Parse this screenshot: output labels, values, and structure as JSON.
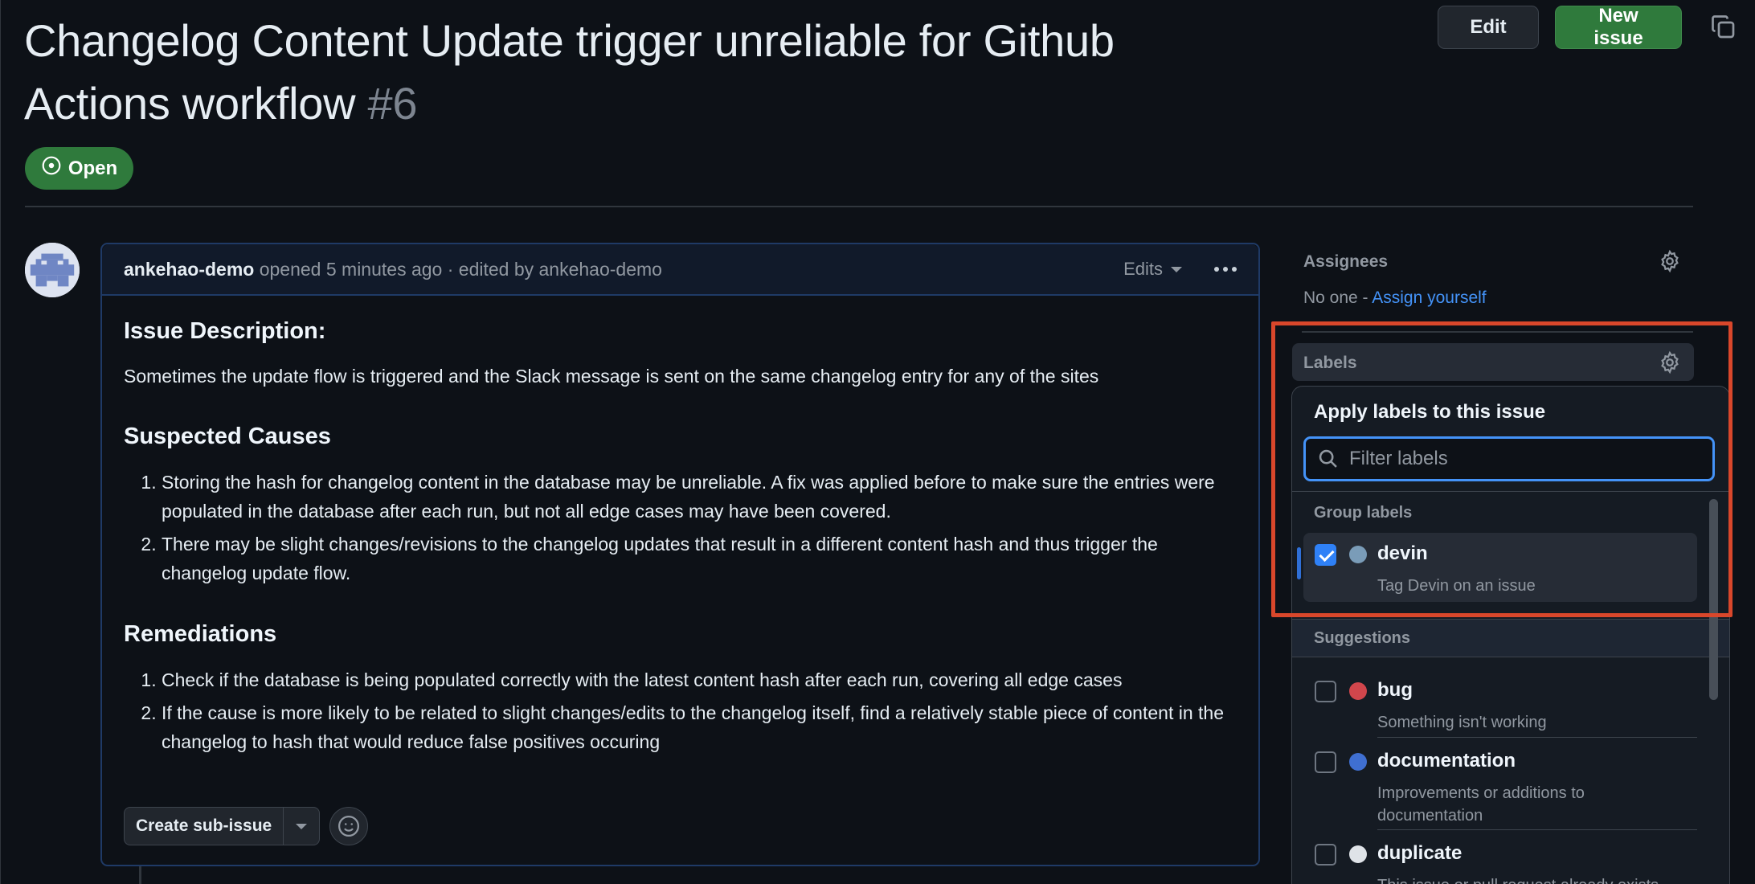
{
  "issue": {
    "title": "Changelog Content Update trigger unreliable for Github Actions workflow",
    "number": "#6",
    "state": "Open"
  },
  "header": {
    "edit_label": "Edit",
    "new_issue_label": "New issue"
  },
  "comment": {
    "author": "ankehao-demo",
    "meta": "opened 5 minutes ago · edited by ankehao-demo",
    "edits_label": "Edits",
    "heading_description": "Issue Description:",
    "description": "Sometimes the update flow is triggered and the Slack message is sent on the same changelog entry for any of the sites",
    "heading_causes": "Suspected Causes",
    "causes": [
      "Storing the hash for changelog content in the database may be unreliable. A fix was applied before to make sure the entries were populated in the database after each run, but not all edge cases may have been covered.",
      "There may be slight changes/revisions to the changelog updates that result in a different content hash and thus trigger the changelog update flow."
    ],
    "heading_remediations": "Remediations",
    "remediations": [
      "Check if the database is being populated correctly with the latest content hash after each run, covering all edge cases",
      "If the cause is more likely to be related to slight changes/edits to the changelog itself, find a relatively stable piece of content in the changelog to hash that would reduce false positives occuring"
    ],
    "create_sub_issue_label": "Create sub-issue"
  },
  "sidebar": {
    "assignees_title": "Assignees",
    "assignees_none": "No one - ",
    "assign_yourself": "Assign yourself",
    "labels_title": "Labels"
  },
  "label_picker": {
    "title": "Apply labels to this issue",
    "filter_placeholder": "Filter labels",
    "group_header": "Group labels",
    "suggestions_header": "Suggestions",
    "group_labels": [
      {
        "name": "devin",
        "description": "Tag Devin on an issue",
        "checked": true,
        "color": "#7a9cb8"
      }
    ],
    "suggestions": [
      {
        "name": "bug",
        "description": "Something isn't working",
        "checked": false,
        "color": "#d1464c"
      },
      {
        "name": "documentation",
        "description": "Improvements or additions to documentation",
        "checked": false,
        "color": "#3f6fd1"
      },
      {
        "name": "duplicate",
        "description": "This issue or pull request already exists",
        "checked": false,
        "color": "#dfe3e8"
      }
    ]
  },
  "colors": {
    "accent": "#4493f8",
    "open_badge": "#2f7a3c",
    "highlight": "#d9472b"
  }
}
